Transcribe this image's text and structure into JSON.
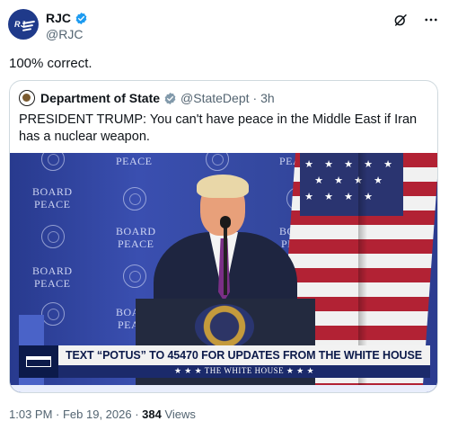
{
  "post": {
    "author": {
      "display_name": "RJC",
      "handle": "@RJC",
      "verified": true,
      "avatar_icon": "rjc-logo-icon"
    },
    "text": "100% correct.",
    "top_actions": [
      {
        "icon": "grok-icon"
      },
      {
        "icon": "more-icon",
        "label": "···"
      }
    ],
    "meta": {
      "time": "1:03 PM",
      "separator1": " · ",
      "date": "Feb 19, 2026",
      "separator2": " · ",
      "views_count": "384",
      "views_label": " Views"
    }
  },
  "quote": {
    "author": {
      "display_name": "Department of State",
      "handle": "@StateDept",
      "time": "· 3h",
      "verified": true,
      "avatar_icon": "state-dept-seal-icon"
    },
    "text": "PRESIDENT TRUMP: You can't have peace in the Middle East if Iran has a nuclear weapon.",
    "media": {
      "backdrop_text": [
        "BOARD OF PEACE"
      ],
      "lower_third": "TEXT “POTUS” TO 45470 FOR UPDATES FROM THE WHITE HOUSE",
      "lower_third_sub": "★ ★ ★   THE WHITE HOUSE   ★ ★ ★"
    }
  },
  "colors": {
    "text": "#0f1419",
    "secondary": "#536471",
    "verified": "#1d9bf0",
    "border": "#cfd9de",
    "backdrop": "#2d3e96"
  }
}
